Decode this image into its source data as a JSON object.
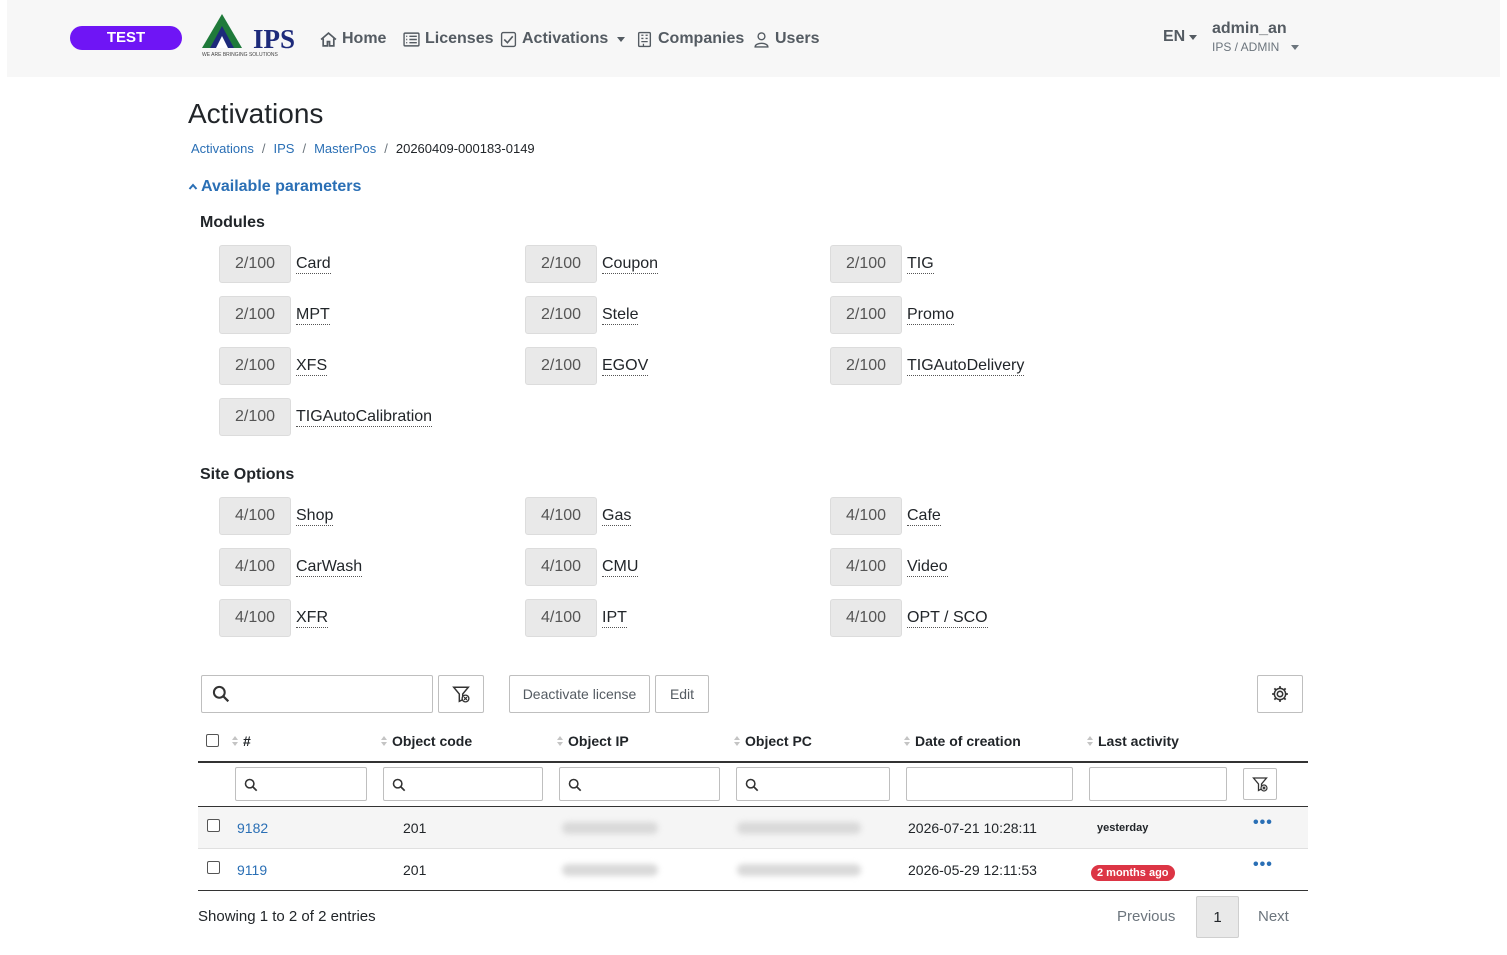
{
  "env_badge": "TEST",
  "brand": {
    "name": "IPS",
    "tagline": "WE ARE BRINGING SOLUTIONS"
  },
  "nav": {
    "home": "Home",
    "licenses": "Licenses",
    "activations": "Activations",
    "companies": "Companies",
    "users": "Users"
  },
  "lang": "EN",
  "user": {
    "name": "admin_an",
    "role": "IPS / ADMIN"
  },
  "page_title": "Activations",
  "breadcrumb": {
    "b1": "Activations",
    "b2": "IPS",
    "b3": "MasterPos",
    "current": "20260409-000183-0149"
  },
  "params_toggle": "Available parameters",
  "modules": {
    "title": "Modules",
    "items": [
      {
        "count": "2/100",
        "name": "Card"
      },
      {
        "count": "2/100",
        "name": "Coupon"
      },
      {
        "count": "2/100",
        "name": "TIG"
      },
      {
        "count": "2/100",
        "name": "MPT"
      },
      {
        "count": "2/100",
        "name": "Stele"
      },
      {
        "count": "2/100",
        "name": "Promo"
      },
      {
        "count": "2/100",
        "name": "XFS"
      },
      {
        "count": "2/100",
        "name": "EGOV"
      },
      {
        "count": "2/100",
        "name": "TIGAutoDelivery"
      },
      {
        "count": "2/100",
        "name": "TIGAutoCalibration"
      }
    ]
  },
  "site_options": {
    "title": "Site Options",
    "items": [
      {
        "count": "4/100",
        "name": "Shop"
      },
      {
        "count": "4/100",
        "name": "Gas"
      },
      {
        "count": "4/100",
        "name": "Cafe"
      },
      {
        "count": "4/100",
        "name": "CarWash"
      },
      {
        "count": "4/100",
        "name": "CMU"
      },
      {
        "count": "4/100",
        "name": "Video"
      },
      {
        "count": "4/100",
        "name": "XFR"
      },
      {
        "count": "4/100",
        "name": "IPT"
      },
      {
        "count": "4/100",
        "name": "OPT / SCO"
      }
    ]
  },
  "toolbar": {
    "deactivate": "Deactivate license",
    "edit": "Edit"
  },
  "table": {
    "columns": {
      "num": "#",
      "code": "Object code",
      "ip": "Object IP",
      "pc": "Object PC",
      "created": "Date of creation",
      "activity": "Last activity"
    },
    "rows": [
      {
        "id": "9182",
        "code": "201",
        "created": "2026-07-21 10:28:11",
        "activity": "yesterday"
      },
      {
        "id": "9119",
        "code": "201",
        "created": "2026-05-29 12:11:53",
        "activity": "2 months ago"
      }
    ]
  },
  "footer": {
    "showing": "Showing 1 to 2 of 2 entries",
    "previous": "Previous",
    "page": "1",
    "next": "Next"
  },
  "colors": {
    "badge": "#6f15f5",
    "link": "#2a6fb5",
    "danger": "#dc3545"
  }
}
